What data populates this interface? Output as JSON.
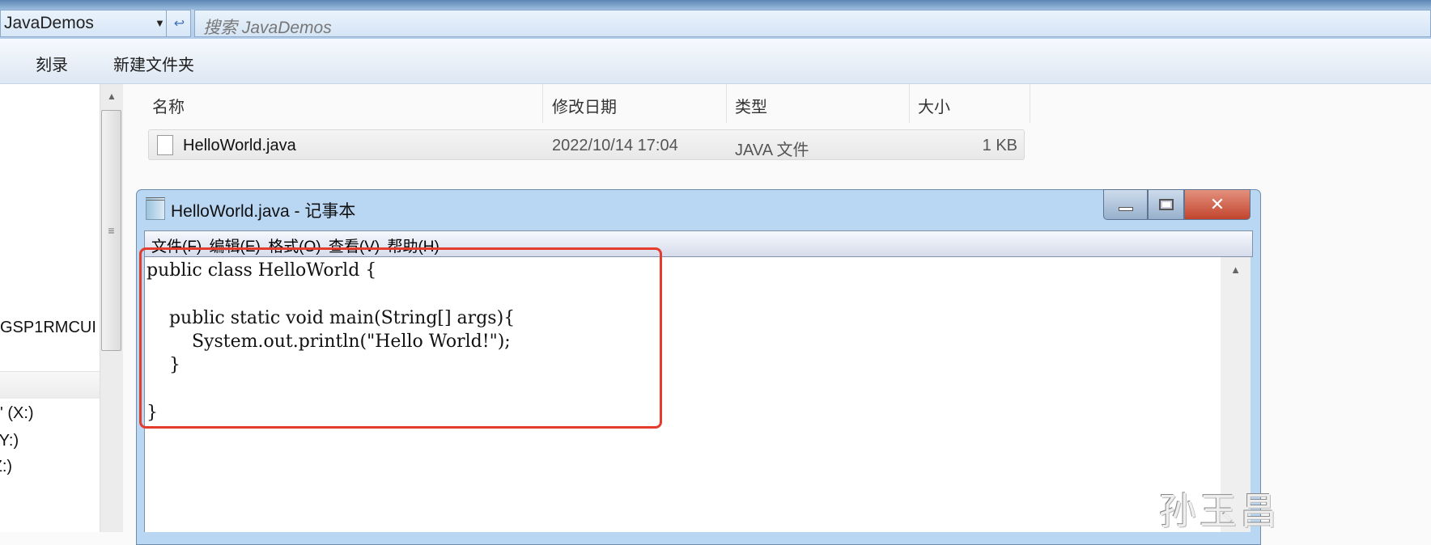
{
  "address": {
    "path": "JavaDemos",
    "search_placeholder": "搜索 JavaDemos"
  },
  "toolbar": {
    "burn": "刻录",
    "new_folder": "新建文件夹"
  },
  "nav": {
    "items": [
      "GSP1RMCUI",
      "c' (X:)",
      "(Y:)",
      "(Z:)"
    ]
  },
  "columns": {
    "name": "名称",
    "modified": "修改日期",
    "type": "类型",
    "size": "大小"
  },
  "files": [
    {
      "name": "HelloWorld.java",
      "modified": "2022/10/14 17:04",
      "type": "JAVA 文件",
      "size": "1 KB"
    }
  ],
  "notepad": {
    "title": "HelloWorld.java - 记事本",
    "menu": [
      "文件(F)",
      "编辑(E)",
      "格式(O)",
      "查看(V)",
      "帮助(H)"
    ],
    "content": "public class HelloWorld {\n\n    public static void main(String[] args){\n        System.out.println(\"Hello World!\");\n    }\n\n}"
  },
  "watermark": "孙玉昌",
  "colors": {
    "highlight": "#e43d2e",
    "close": "#c2442c"
  }
}
